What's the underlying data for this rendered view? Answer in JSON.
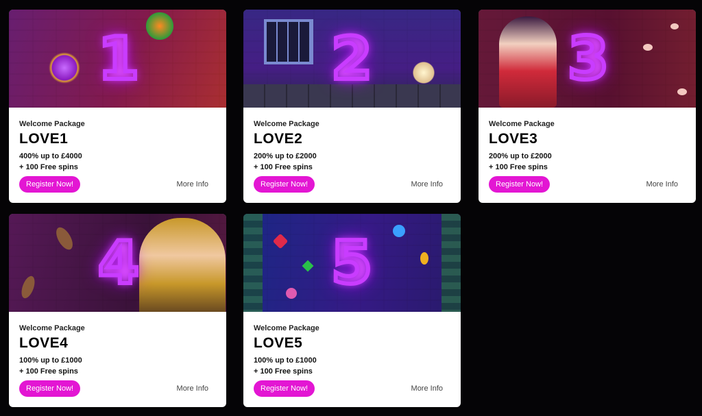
{
  "cards": [
    {
      "heading": "Welcome Package",
      "code": "LOVE1",
      "offer1": "400% up to £4000",
      "offer2": "+ 100 Free spins",
      "register": "Register Now!",
      "more": "More Info",
      "banner_number": "1"
    },
    {
      "heading": "Welcome Package",
      "code": "LOVE2",
      "offer1": "200% up to £2000",
      "offer2": "+ 100 Free spins",
      "register": "Register Now!",
      "more": "More Info",
      "banner_number": "2"
    },
    {
      "heading": "Welcome Package",
      "code": "LOVE3",
      "offer1": "200% up to £2000",
      "offer2": "+ 100 Free spins",
      "register": "Register Now!",
      "more": "More Info",
      "banner_number": "3"
    },
    {
      "heading": "Welcome Package",
      "code": "LOVE4",
      "offer1": "100% up to £1000",
      "offer2": "+ 100 Free spins",
      "register": "Register Now!",
      "more": "More Info",
      "banner_number": "4"
    },
    {
      "heading": "Welcome Package",
      "code": "LOVE5",
      "offer1": "100% up to £1000",
      "offer2": "+ 100 Free spins",
      "register": "Register Now!",
      "more": "More Info",
      "banner_number": "5"
    }
  ],
  "colors": {
    "accent": "#e316d3",
    "neon": "#c93cff",
    "page_bg": "#050406"
  }
}
